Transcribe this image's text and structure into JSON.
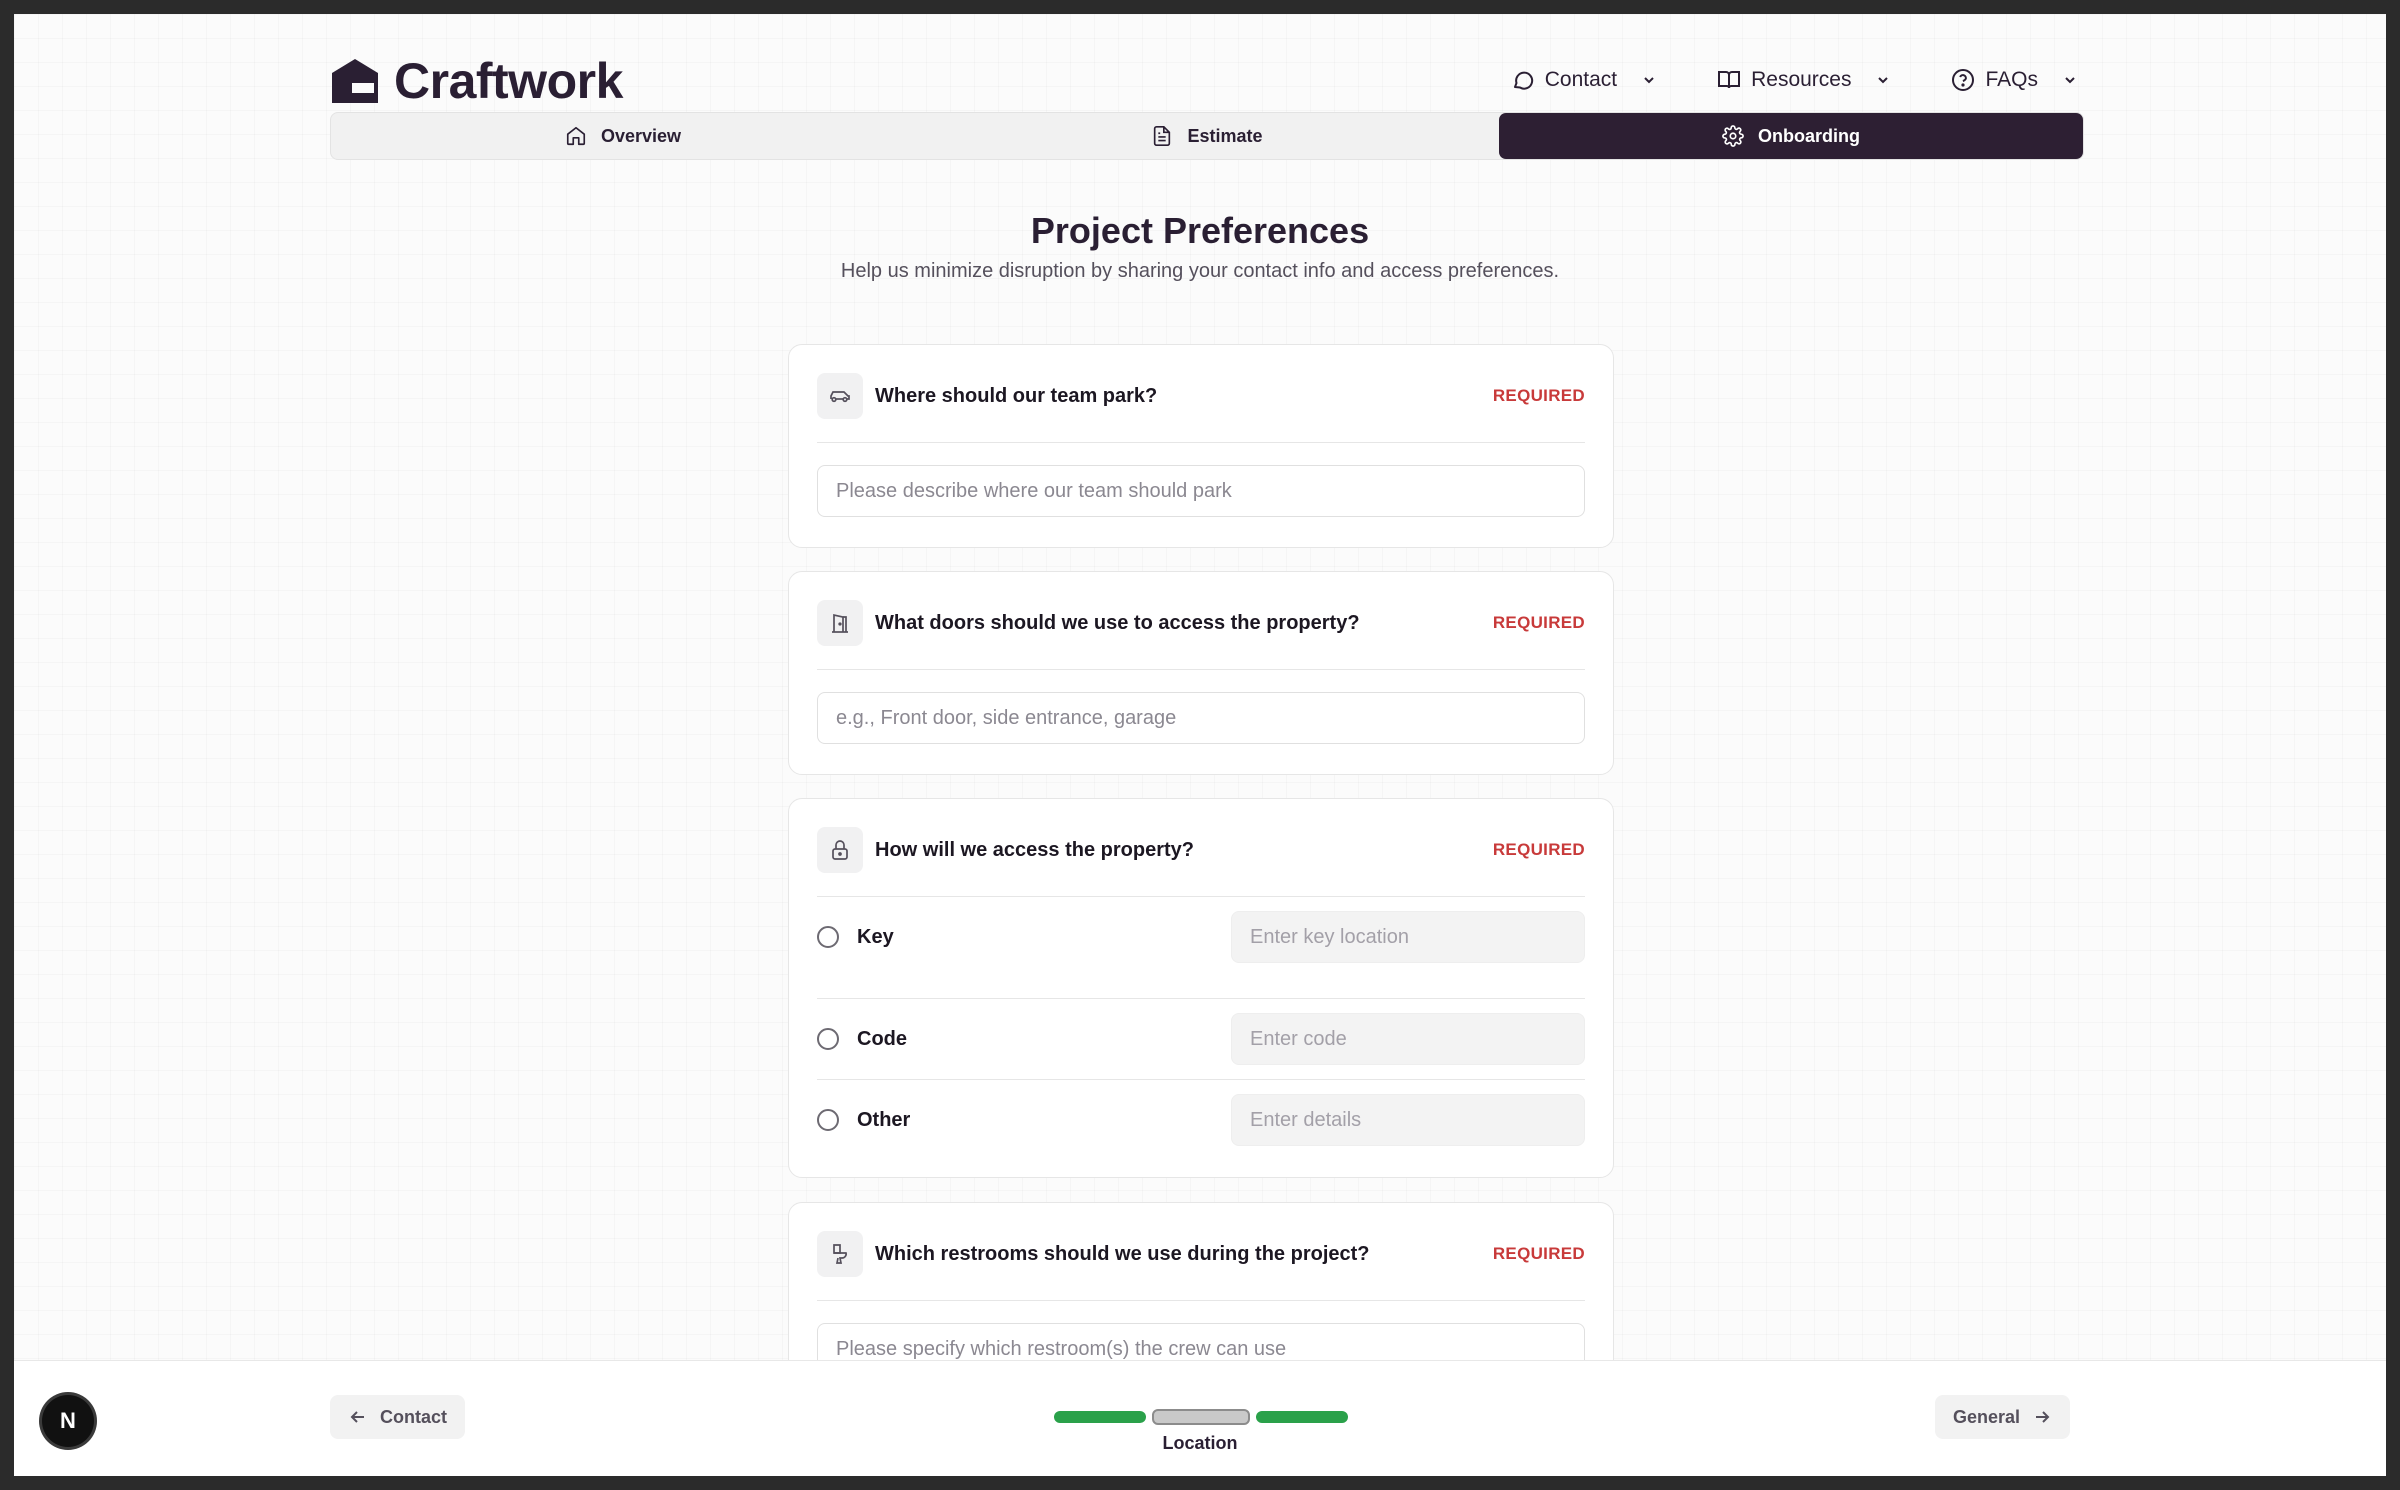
{
  "brand": {
    "name": "Craftwork"
  },
  "nav": {
    "contact": "Contact",
    "resources": "Resources",
    "faqs": "FAQs"
  },
  "tabs": [
    {
      "label": "Overview",
      "active": false
    },
    {
      "label": "Estimate",
      "active": false
    },
    {
      "label": "Onboarding",
      "active": true
    }
  ],
  "page": {
    "title": "Project Preferences",
    "subtitle": "Help us minimize disruption by sharing your contact info and access preferences."
  },
  "required_label": "REQUIRED",
  "questions": {
    "parking": {
      "question": "Where should our team park?",
      "placeholder": "Please describe where our team should park",
      "value": ""
    },
    "doors": {
      "question": "What doors should we use to access the property?",
      "placeholder": "e.g., Front door, side entrance, garage",
      "value": ""
    },
    "access": {
      "question": "How will we access the property?",
      "options": [
        {
          "label": "Key",
          "placeholder": "Enter key location",
          "selected": false
        },
        {
          "label": "Code",
          "placeholder": "Enter code",
          "selected": false
        },
        {
          "label": "Other",
          "placeholder": "Enter details",
          "selected": false
        }
      ]
    },
    "restrooms": {
      "question": "Which restrooms should we use during the project?",
      "placeholder": "Please specify which restroom(s) the crew can use",
      "value": ""
    }
  },
  "footer": {
    "badge": "N",
    "back_label": "Contact",
    "next_label": "General",
    "step_label": "Location",
    "steps": [
      {
        "state": "complete"
      },
      {
        "state": "current"
      },
      {
        "state": "complete"
      }
    ]
  },
  "colors": {
    "brand": "#2a1f33",
    "active_tab": "#2d1f33",
    "required": "#c83a3a",
    "progress_complete": "#2aa14a"
  }
}
